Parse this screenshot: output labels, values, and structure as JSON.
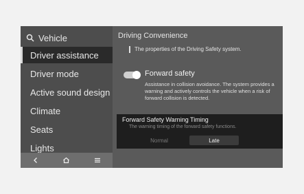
{
  "sidebar": {
    "search_label": "Vehicle",
    "items": [
      {
        "label": "Driver assistance",
        "selected": true
      },
      {
        "label": "Driver mode",
        "selected": false
      },
      {
        "label": "Active sound design",
        "selected": false
      },
      {
        "label": "Climate",
        "selected": false
      },
      {
        "label": "Seats",
        "selected": false
      },
      {
        "label": "Lights",
        "selected": false
      }
    ]
  },
  "bottom_bar": {
    "back_icon": "chevron-left-icon",
    "home_icon": "home-icon",
    "menu_icon": "menu-icon"
  },
  "main": {
    "title": "Driving Convenience",
    "description": "The properties of the Driving Safety system.",
    "forward_safety": {
      "label": "Forward safety",
      "enabled": true,
      "description": "Assistance in collision avoidance. The system provides a warning and actively controls the vehicle when a risk of  forward collision is detected."
    }
  },
  "popup": {
    "title": "Forward Safety Warning Timing",
    "description": "The warning timing of the forward safety functions.",
    "options": [
      {
        "label": "Normal",
        "selected": false
      },
      {
        "label": "Late",
        "selected": true
      }
    ]
  },
  "colors": {
    "screen_bg": "#5a5a5a",
    "sidebar_bg": "#4d4d4d",
    "selected_bg": "#2a2a2a",
    "popup_bg": "#1e1e1e"
  }
}
